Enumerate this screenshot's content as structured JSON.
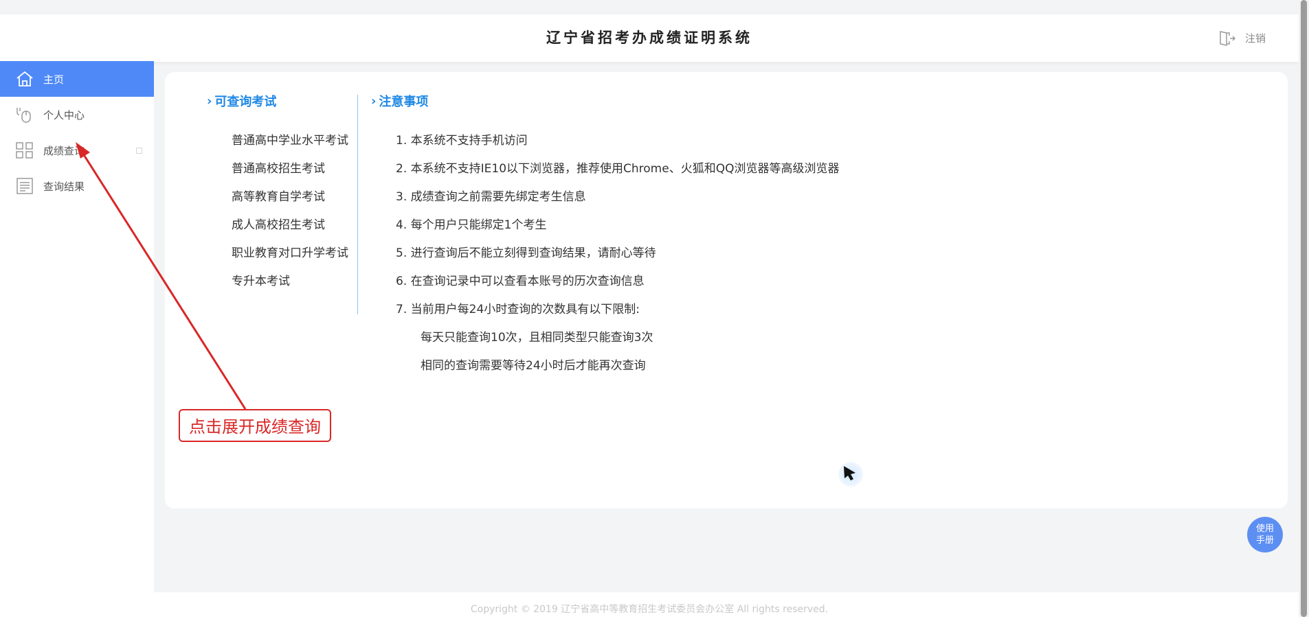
{
  "header": {
    "title": "辽宁省招考办成绩证明系统",
    "logout_label": "注销"
  },
  "sidebar": {
    "items": [
      {
        "label": "主页",
        "icon": "home-icon"
      },
      {
        "label": "个人中心",
        "icon": "mouse-icon"
      },
      {
        "label": "成绩查询",
        "icon": "grid-icon"
      },
      {
        "label": "查询结果",
        "icon": "document-icon"
      }
    ]
  },
  "main": {
    "exams_title": "可查询考试",
    "exams": [
      "普通高中学业水平考试",
      "普通高校招生考试",
      "高等教育自学考试",
      "成人高校招生考试",
      "职业教育对口升学考试",
      "专升本考试"
    ],
    "notes_title": "注意事项",
    "notes": [
      "1. 本系统不支持手机访问",
      "2. 本系统不支持IE10以下浏览器，推荐使用Chrome、火狐和QQ浏览器等高级浏览器",
      "3. 成绩查询之前需要先绑定考生信息",
      "4. 每个用户只能绑定1个考生",
      "5. 进行查询后不能立刻得到查询结果，请耐心等待",
      "6. 在查询记录中可以查看本账号的历次查询信息",
      "7. 当前用户每24小时查询的次数具有以下限制:"
    ],
    "sub_notes": [
      "每天只能查询10次，且相同类型只能查询3次",
      "相同的查询需要等待24小时后才能再次查询"
    ]
  },
  "annotation": {
    "text": "点击展开成绩查询"
  },
  "manual": {
    "line1": "使用",
    "line2": "手册"
  },
  "footer": {
    "copyright": "Copyright © 2019 辽宁省高中等教育招生考试委员会办公室 All rights reserved."
  },
  "colors": {
    "accent": "#4e89f7",
    "title_blue": "#1e88e5",
    "annotation_red": "#d92727"
  }
}
